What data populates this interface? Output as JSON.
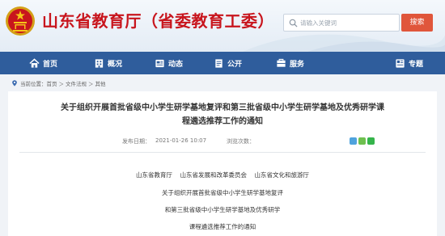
{
  "site": {
    "title": "山东省教育厅（省委教育工委）"
  },
  "search": {
    "placeholder": "请输入关键词",
    "button_label": "搜索"
  },
  "nav": {
    "items": [
      {
        "label": "首页",
        "icon": "home-icon"
      },
      {
        "label": "概况",
        "icon": "building-icon"
      },
      {
        "label": "动态",
        "icon": "news-icon"
      },
      {
        "label": "公开",
        "icon": "disclosure-icon"
      },
      {
        "label": "服务",
        "icon": "service-icon"
      },
      {
        "label": "专题",
        "icon": "topic-icon"
      }
    ]
  },
  "breadcrumb": {
    "prefix": "当前位置：",
    "items": [
      "首页",
      "文件法规",
      "其他"
    ],
    "separator": "＞"
  },
  "article": {
    "title_line1": "关于组织开展首批省级中小学生研学基地复评和第三批省级中小学生研学基地及优秀研学课",
    "title_line2": "程遴选推荐工作的通知",
    "publish_label": "发布日期：",
    "publish_date": "2021-01-26 10:07",
    "views_label": "浏览次数：",
    "body_lines": [
      "山东省教育厅    山东省发展和改革委员会    山东省文化和旅游厅",
      "关于组织开展首批省级中小学生研学基地复评",
      "和第三批省级中小学生研学基地及优秀研学",
      "课程遴选推荐工作的通知"
    ]
  },
  "colors": {
    "title_red": "#c8151d",
    "nav_blue": "#2f5d9c",
    "search_button": "#e0563b"
  }
}
